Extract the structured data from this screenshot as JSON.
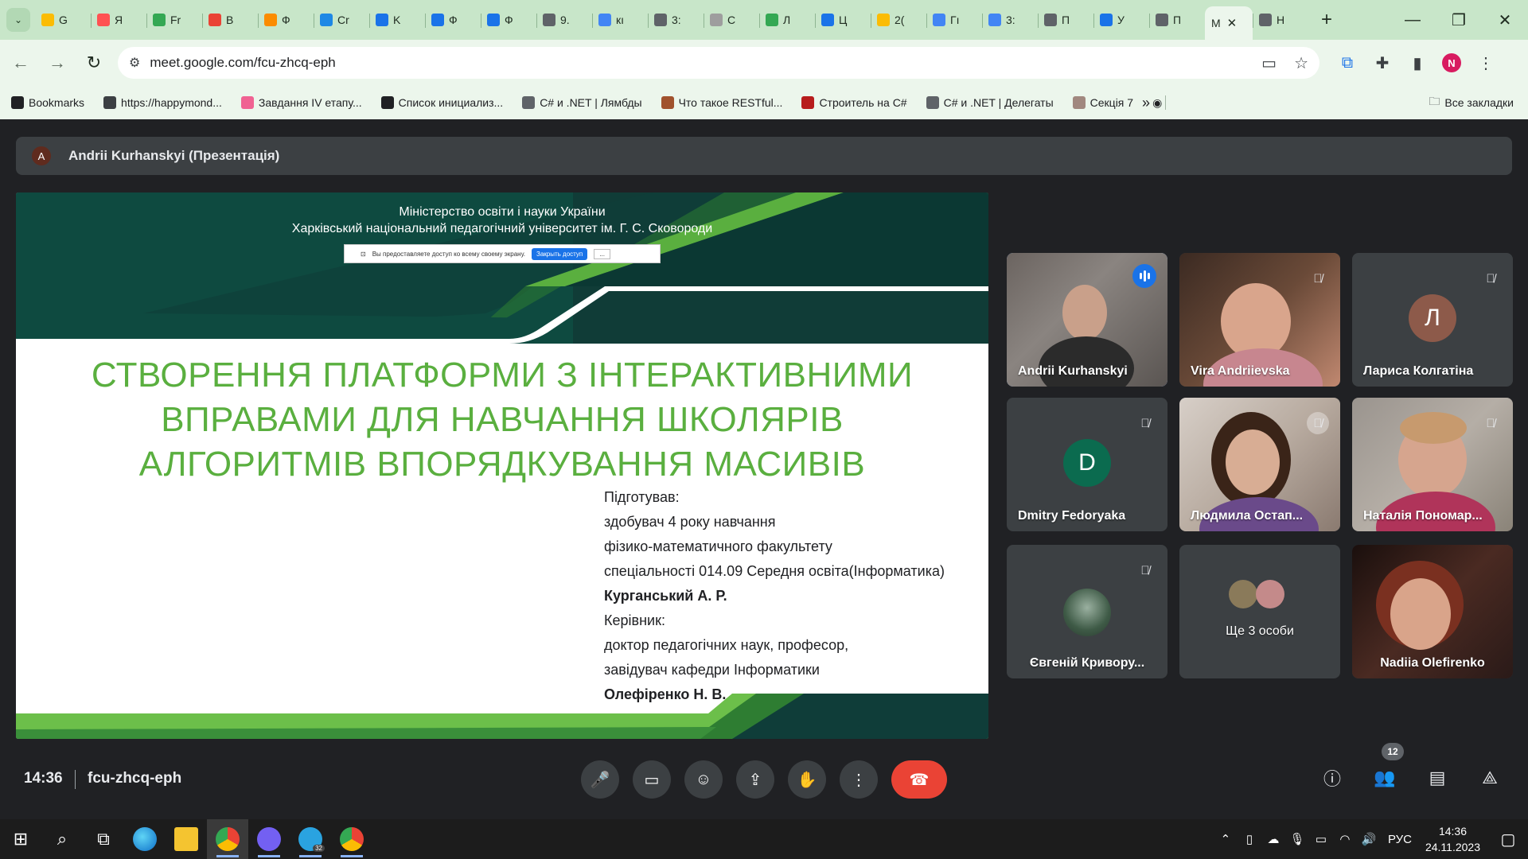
{
  "browser": {
    "tabs": [
      {
        "label": "G",
        "color": "#fbbc04"
      },
      {
        "label": "Я",
        "color": "#ff5252"
      },
      {
        "label": "Fr",
        "color": "#34a853"
      },
      {
        "label": "B",
        "color": "#ea4335"
      },
      {
        "label": "Ф",
        "color": "#fb8c00"
      },
      {
        "label": "Cr",
        "color": "#1e88e5"
      },
      {
        "label": "K",
        "color": "#1a73e8"
      },
      {
        "label": "Ф",
        "color": "#1a73e8"
      },
      {
        "label": "Ф",
        "color": "#1a73e8"
      },
      {
        "label": "9.",
        "color": "#5f6368"
      },
      {
        "label": "кı",
        "color": "#4285f4"
      },
      {
        "label": "3:",
        "color": "#5f6368"
      },
      {
        "label": "С",
        "color": "#9e9e9e"
      },
      {
        "label": "Л",
        "color": "#34a853"
      },
      {
        "label": "Ц",
        "color": "#1a73e8"
      },
      {
        "label": "2(",
        "color": "#fbbc04"
      },
      {
        "label": "Гı",
        "color": "#4285f4"
      },
      {
        "label": "3:",
        "color": "#4285f4"
      },
      {
        "label": "П",
        "color": "#5f6368"
      },
      {
        "label": "У",
        "color": "#1a73e8"
      },
      {
        "label": "П",
        "color": "#5f6368"
      }
    ],
    "active_tab": {
      "label": "М",
      "close": "✕"
    },
    "after_tab": {
      "label": "Н",
      "color": "#5f6368"
    },
    "new_tab": "+",
    "url": "meet.google.com/fcu-zhcq-eph",
    "profile_initial": "N",
    "bookmarks": [
      {
        "label": "Bookmarks",
        "color": "#202124"
      },
      {
        "label": "https://happymond...",
        "color": "#3c4043"
      },
      {
        "label": "Завдання IV етапу...",
        "color": "#f06292"
      },
      {
        "label": "Список инициализ...",
        "color": "#202124"
      },
      {
        "label": "C# и .NET | Лямбды",
        "color": "#5f6368"
      },
      {
        "label": "Что такое RESTful...",
        "color": "#a0522d"
      },
      {
        "label": "Строитель на C#",
        "color": "#b71c1c"
      },
      {
        "label": "C# и .NET | Делегаты",
        "color": "#5f6368"
      },
      {
        "label": "Секція 7",
        "color": "#a1887f"
      }
    ],
    "all_bookmarks": "Все закладки"
  },
  "meet": {
    "presenter_initial": "A",
    "presenter_label": "Andrii Kurhanskyi (Презентація)",
    "slide": {
      "ministry_line1": "Міністерство освіти і науки України",
      "ministry_line2": "Харківський національний педагогічний університет ім. Г. С. Сковороди",
      "share_text": "Вы предоставляете доступ ко всему своему экрану.",
      "share_stop": "Закрыть доступ",
      "share_hide": "...",
      "title_line1": "СТВОРЕННЯ ПЛАТФОРМИ З ІНТЕРАКТИВНИМИ",
      "title_line2": "ВПРАВАМИ ДЛЯ НАВЧАННЯ ШКОЛЯРІВ",
      "title_line3": "АЛГОРИТМІВ ВПОРЯДКУВАННЯ МАСИВІВ",
      "credits": [
        "Підготував:",
        "здобувач 4 року навчання",
        "фізико-математичного факультету",
        "спеціальності 014.09 Середня освіта(Інформатика)",
        "Курганський А. Р.",
        "Керівник:",
        "доктор педагогічних наук, професор,",
        "завідувач кафедри Інформатики",
        "Олефіренко Н. В."
      ]
    },
    "participants": [
      {
        "name": "Andrii Kurhanskyi"
      },
      {
        "name": "Vira Andriievska"
      },
      {
        "name": "Лариса Колгатіна",
        "initial": "Л",
        "avatar_color": "#8d5a4a"
      },
      {
        "name": "Dmitry Fedoryaka",
        "initial": "D",
        "avatar_color": "#0b6b4f"
      },
      {
        "name": "Людмила Остап..."
      },
      {
        "name": "Наталія Пономар..."
      },
      {
        "name": "Євгеній Кривору..."
      },
      {
        "name": "Ще 3 особи"
      },
      {
        "name": "Nadiia Olefirenko"
      }
    ],
    "time": "14:36",
    "meeting_code": "fcu-zhcq-eph",
    "participant_count": "12"
  },
  "taskbar": {
    "lang": "РУС",
    "time": "14:36",
    "date": "24.11.2023",
    "telegram_badge": "32"
  }
}
